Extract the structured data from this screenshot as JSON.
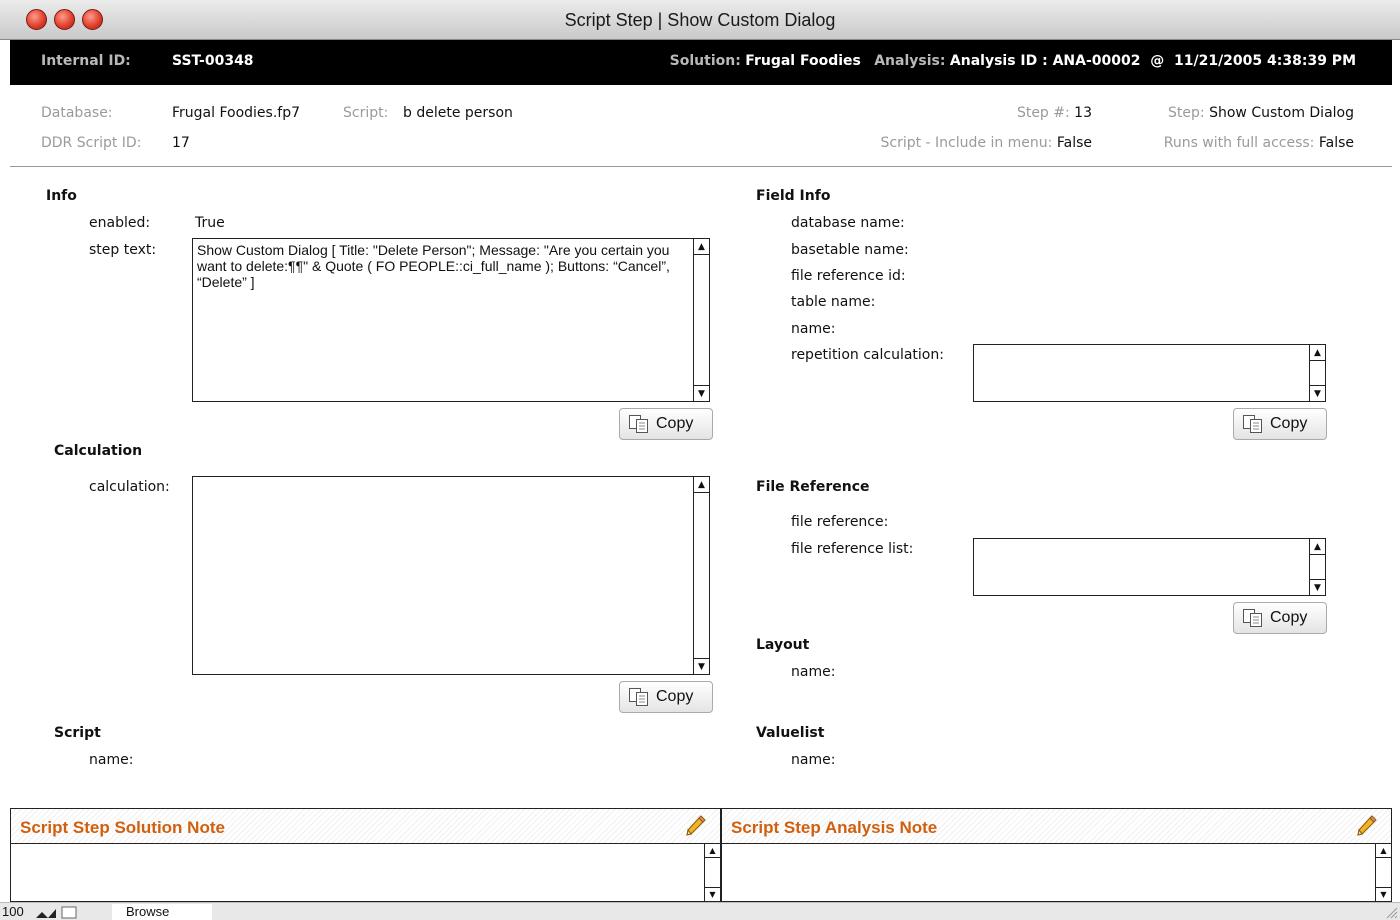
{
  "window": {
    "title": "Script Step  |  Show Custom Dialog"
  },
  "header": {
    "internal_id_label": "Internal ID:",
    "internal_id_value": "SST-00348",
    "solution_label": "Solution:",
    "solution_value": "Frugal Foodies",
    "analysis_label": "Analysis:",
    "analysis_value": "Analysis ID : ANA-00002  @  11/21/2005 4:38:39 PM"
  },
  "meta": {
    "database_label": "Database:",
    "database_value": "Frugal Foodies.fp7",
    "script_label": "Script:",
    "script_value": "b delete person",
    "ddr_label": "DDR Script ID:",
    "ddr_value": "17",
    "step_num_label": "Step #:",
    "step_num_value": "13",
    "step_label": "Step:",
    "step_value": "Show Custom Dialog",
    "include_menu_label": "Script - Include in menu:",
    "include_menu_value": "False",
    "full_access_label": "Runs with full access:",
    "full_access_value": "False"
  },
  "info": {
    "title": "Info",
    "enabled_label": "enabled:",
    "enabled_value": "True",
    "step_text_label": "step text:",
    "step_text_value": "Show Custom Dialog [ Title: \"Delete Person\"; Message: \"Are you certain you want to delete:¶¶\" & Quote ( FO PEOPLE::ci_full_name ); Buttons: “Cancel”, “Delete” ]",
    "copy_label": "Copy"
  },
  "calculation": {
    "title": "Calculation",
    "calc_label": "calculation:",
    "copy_label": "Copy"
  },
  "script": {
    "title": "Script",
    "name_label": "name:"
  },
  "field_info": {
    "title": "Field Info",
    "database_name_label": "database name:",
    "basetable_name_label": "basetable name:",
    "file_ref_id_label": "file reference id:",
    "table_name_label": "table name:",
    "name_label": "name:",
    "rep_calc_label": "repetition calculation:",
    "copy_label": "Copy"
  },
  "file_reference": {
    "title": "File Reference",
    "file_ref_label": "file reference:",
    "file_ref_list_label": "file reference list:",
    "copy_label": "Copy"
  },
  "layout": {
    "title": "Layout",
    "name_label": "name:"
  },
  "valuelist": {
    "title": "Valuelist",
    "name_label": "name:"
  },
  "notes": {
    "solution_title": "Script Step Solution Note",
    "analysis_title": "Script Step Analysis Note"
  },
  "status": {
    "zoom": "100",
    "mode": "Browse"
  },
  "colors": {
    "note_title": "#d0600e",
    "header_bg": "#000000",
    "label_gray": "#9a9a9a"
  }
}
